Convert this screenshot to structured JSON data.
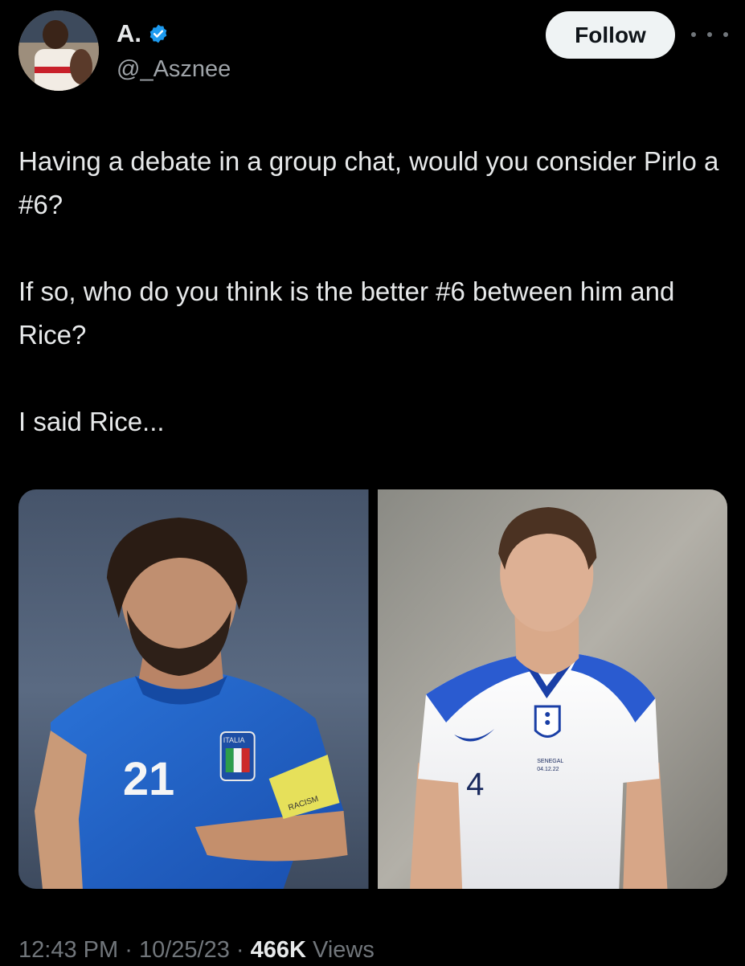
{
  "author": {
    "display_name": "A.",
    "handle": "@_Asznee",
    "verified": true,
    "verified_color": "#1d9bf0",
    "avatar_icon": "profile-photo"
  },
  "actions": {
    "follow_label": "Follow",
    "more_icon": "more-horizontal-icon"
  },
  "tweet": {
    "paragraphs": [
      "Having a debate in a group chat, would you consider Pirlo a #6?",
      "If so, who do you think is the better #6 between him and Rice?",
      "I said Rice..."
    ]
  },
  "media": [
    {
      "subject": "player-photo-pirlo",
      "shirt_number": "21",
      "badge_text": "ITALIA",
      "armband_text": "RACISM"
    },
    {
      "subject": "player-photo-rice",
      "shirt_number": "4",
      "shirt_caption_line1": "SENEGAL",
      "shirt_caption_line2": "04.12.22"
    }
  ],
  "meta": {
    "time": "12:43 PM",
    "date": "10/25/23",
    "separator": "·",
    "views_count": "466K",
    "views_label": "Views"
  },
  "colors": {
    "background": "#000000",
    "text": "#e7e9ea",
    "muted": "#71767b",
    "follow_bg": "#eff3f4",
    "italy_blue": "#1f5fc4",
    "england_white": "#f2f2f4",
    "england_blue": "#1a3fa6"
  }
}
